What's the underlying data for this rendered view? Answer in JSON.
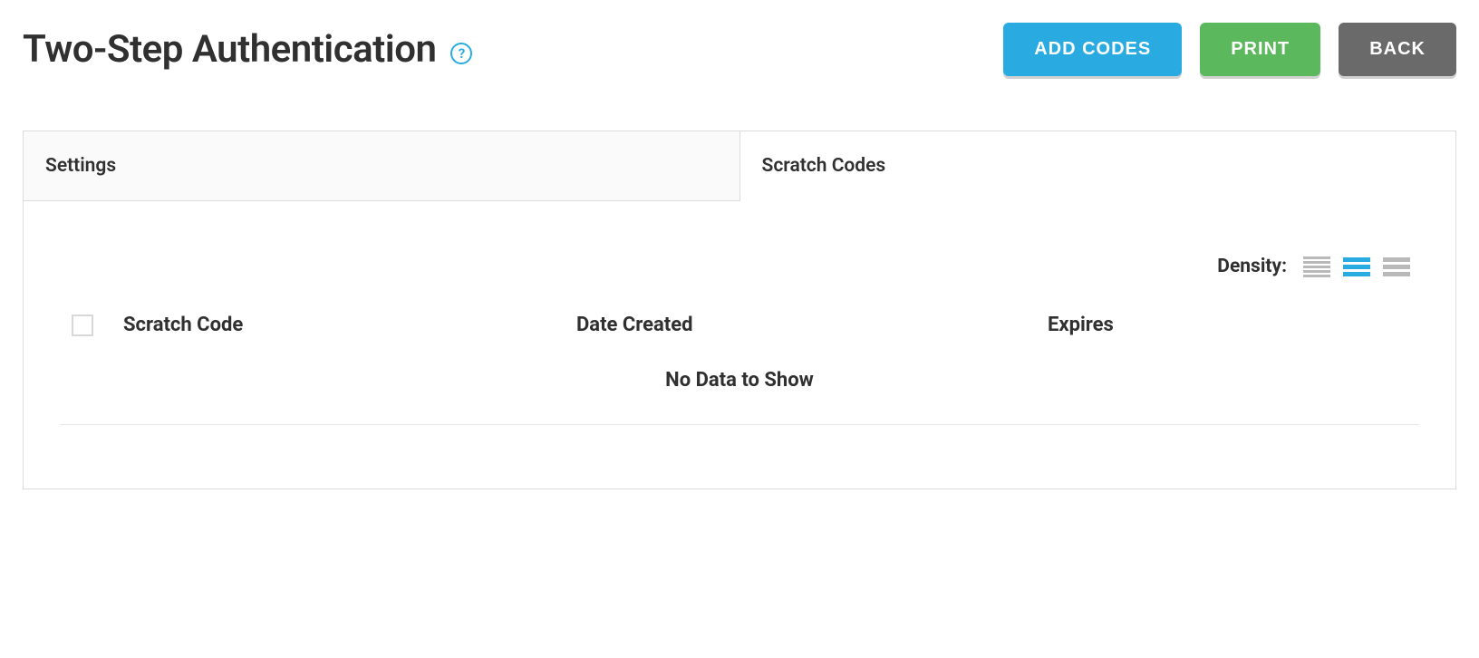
{
  "header": {
    "title": "Two-Step Authentication",
    "help_glyph": "?",
    "buttons": {
      "add_codes": "ADD CODES",
      "print": "PRINT",
      "back": "BACK"
    }
  },
  "tabs": {
    "settings": "Settings",
    "scratch_codes": "Scratch Codes"
  },
  "density": {
    "label": "Density:"
  },
  "table": {
    "columns": {
      "scratch_code": "Scratch Code",
      "date_created": "Date Created",
      "expires": "Expires"
    },
    "empty_message": "No Data to Show"
  }
}
